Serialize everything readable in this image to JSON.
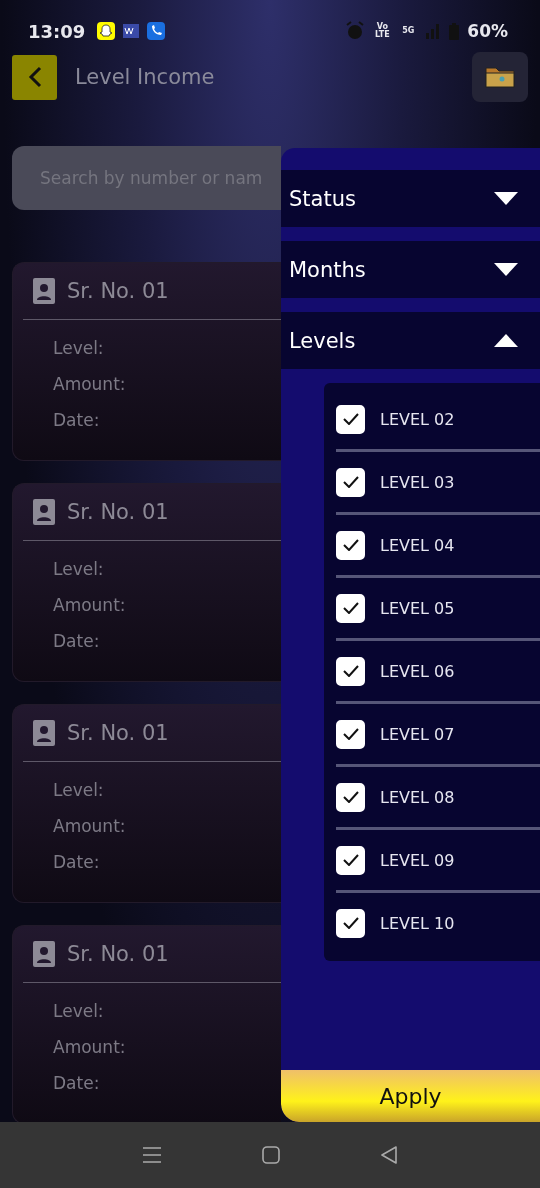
{
  "status_bar": {
    "time": "13:09",
    "network_label": "Vo LTE",
    "signal_label": "5G",
    "battery": "60%"
  },
  "header": {
    "title": "Level Income"
  },
  "search": {
    "placeholder": "Search by number or nam"
  },
  "cards": [
    {
      "title": "Sr. No. 01",
      "fields": [
        "Level:",
        "Amount:",
        "Date:"
      ]
    },
    {
      "title": "Sr. No. 01",
      "fields": [
        "Level:",
        "Amount:",
        "Date:"
      ]
    },
    {
      "title": "Sr. No. 01",
      "fields": [
        "Level:",
        "Amount:",
        "Date:"
      ]
    },
    {
      "title": "Sr. No. 01",
      "fields": [
        "Level:",
        "Amount:",
        "Date:"
      ]
    }
  ],
  "filter_panel": {
    "sections": [
      {
        "label": "Status",
        "expanded": false
      },
      {
        "label": "Months",
        "expanded": false
      },
      {
        "label": "Levels",
        "expanded": true,
        "items": [
          {
            "label": "LEVEL 02",
            "checked": true
          },
          {
            "label": "LEVEL 03",
            "checked": true
          },
          {
            "label": "LEVEL 04",
            "checked": true
          },
          {
            "label": "LEVEL 05",
            "checked": true
          },
          {
            "label": "LEVEL 06",
            "checked": true
          },
          {
            "label": "LEVEL 07",
            "checked": true
          },
          {
            "label": "LEVEL 08",
            "checked": true
          },
          {
            "label": "LEVEL 09",
            "checked": true
          },
          {
            "label": "LEVEL 10",
            "checked": true
          }
        ]
      }
    ],
    "apply": "Apply"
  }
}
